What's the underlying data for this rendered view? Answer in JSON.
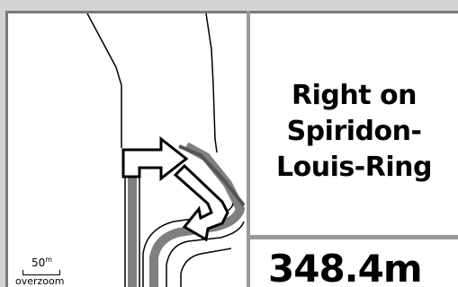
{
  "map": {
    "scale_value": "50",
    "scale_unit": "m",
    "zoom_label": "overzoom"
  },
  "instruction": {
    "lines": [
      "Right on",
      "Spiridon-",
      "Louis-Ring"
    ]
  },
  "distance": {
    "value": "348.4m"
  },
  "colors": {
    "route": "#7f7f7f",
    "road": "#000000",
    "background": "#ffffff",
    "bezel": "#d4d4d4"
  }
}
